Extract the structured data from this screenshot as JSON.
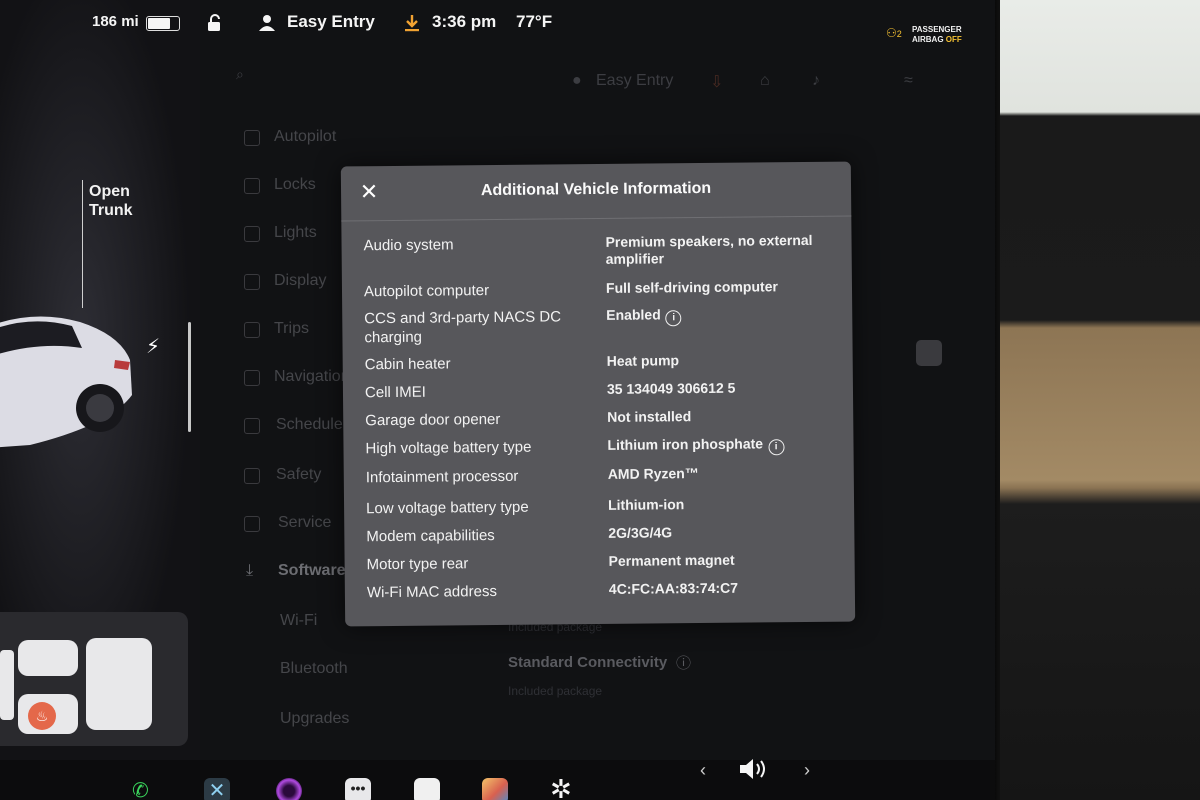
{
  "status_bar": {
    "range": "186 mi",
    "driver_profile": "Easy Entry",
    "time": "3:36 pm",
    "temperature": "77°F",
    "airbag_line1": "PASSENGER",
    "airbag_line2": "AIRBAG",
    "airbag_state": "OFF",
    "airbag_seat_num": "2"
  },
  "car_panel": {
    "trunk_label_line1": "Open",
    "trunk_label_line2": "Trunk"
  },
  "background_menu": {
    "profile": "Easy Entry",
    "items": [
      "Autopilot",
      "Locks",
      "Lights",
      "Display",
      "Trips",
      "Navigation",
      "Schedule",
      "Safety",
      "Service",
      "Software",
      "Wi-Fi",
      "Bluetooth",
      "Upgrades"
    ],
    "standard_connectivity": "Standard Connectivity",
    "included_package_1": "Included package",
    "included_package_2": "Included package"
  },
  "modal": {
    "title": "Additional Vehicle Information",
    "rows": [
      {
        "key": "Audio system",
        "value": "Premium speakers, no external amplifier",
        "info": false
      },
      {
        "key": "Autopilot computer",
        "value": "Full self-driving computer",
        "info": false
      },
      {
        "key": "CCS and 3rd-party NACS DC charging",
        "value": "Enabled",
        "info": true
      },
      {
        "key": "Cabin heater",
        "value": "Heat pump",
        "info": false
      },
      {
        "key": "Cell IMEI",
        "value": "35 134049 306612 5",
        "info": false
      },
      {
        "key": "Garage door opener",
        "value": "Not installed",
        "info": false
      },
      {
        "key": "High voltage battery type",
        "value": "Lithium iron phosphate",
        "info": true
      },
      {
        "key": "Infotainment processor",
        "value": "AMD Ryzen™",
        "info": false
      },
      {
        "key": "Low voltage battery type",
        "value": "Lithium-ion",
        "info": false
      },
      {
        "key": "Modem capabilities",
        "value": "2G/3G/4G",
        "info": false
      },
      {
        "key": "Motor type rear",
        "value": "Permanent magnet",
        "info": false
      },
      {
        "key": "Wi-Fi MAC address",
        "value": "4C:FC:AA:83:74:C7",
        "info": false
      }
    ]
  },
  "icons": {
    "close": "close-icon",
    "info": "info-icon",
    "lock": "unlock-icon",
    "profile": "person-icon",
    "download": "download-icon"
  },
  "colors": {
    "modal_bg": "#57575b",
    "accent_yellow": "#f5c132",
    "download_orange": "#f0a232"
  }
}
